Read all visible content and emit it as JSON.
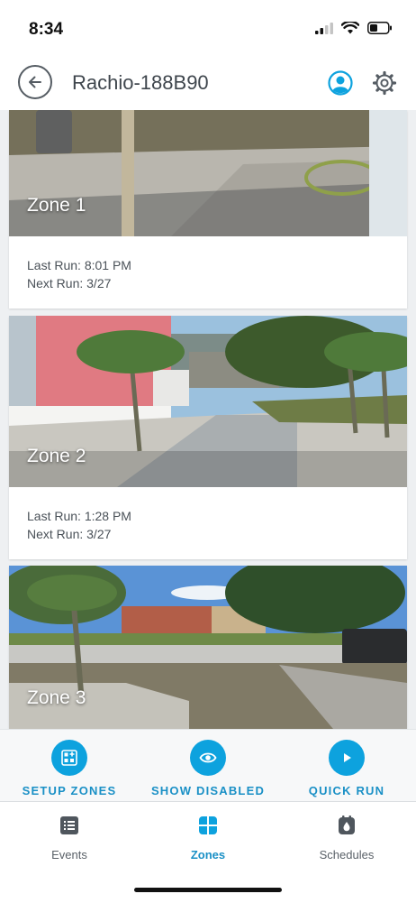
{
  "status_bar": {
    "time": "8:34",
    "icons": [
      "signal-icon",
      "wifi-icon",
      "battery-icon"
    ]
  },
  "header": {
    "title": "Rachio-188B90",
    "icons": [
      "back-arrow-icon",
      "account-icon",
      "gear-icon"
    ]
  },
  "zones": [
    {
      "name": "Zone 1",
      "last_run": "Last Run: 8:01 PM",
      "next_run": "Next Run: 3/27"
    },
    {
      "name": "Zone 2",
      "last_run": "Last Run: 1:28 PM",
      "next_run": "Next Run: 3/27"
    },
    {
      "name": "Zone 3"
    }
  ],
  "actions": [
    {
      "label": "SETUP ZONES",
      "icon": "setup-zones-icon"
    },
    {
      "label": "SHOW DISABLED",
      "icon": "eye-icon"
    },
    {
      "label": "QUICK RUN",
      "icon": "play-icon"
    }
  ],
  "tabs": [
    {
      "label": "Events",
      "icon": "events-list-icon",
      "active": false
    },
    {
      "label": "Zones",
      "icon": "zones-grid-icon",
      "active": true
    },
    {
      "label": "Schedules",
      "icon": "schedules-drop-icon",
      "active": false
    }
  ],
  "colors": {
    "accent": "#0da2de",
    "accent_text": "#1a90c6",
    "title": "#3f464d"
  }
}
